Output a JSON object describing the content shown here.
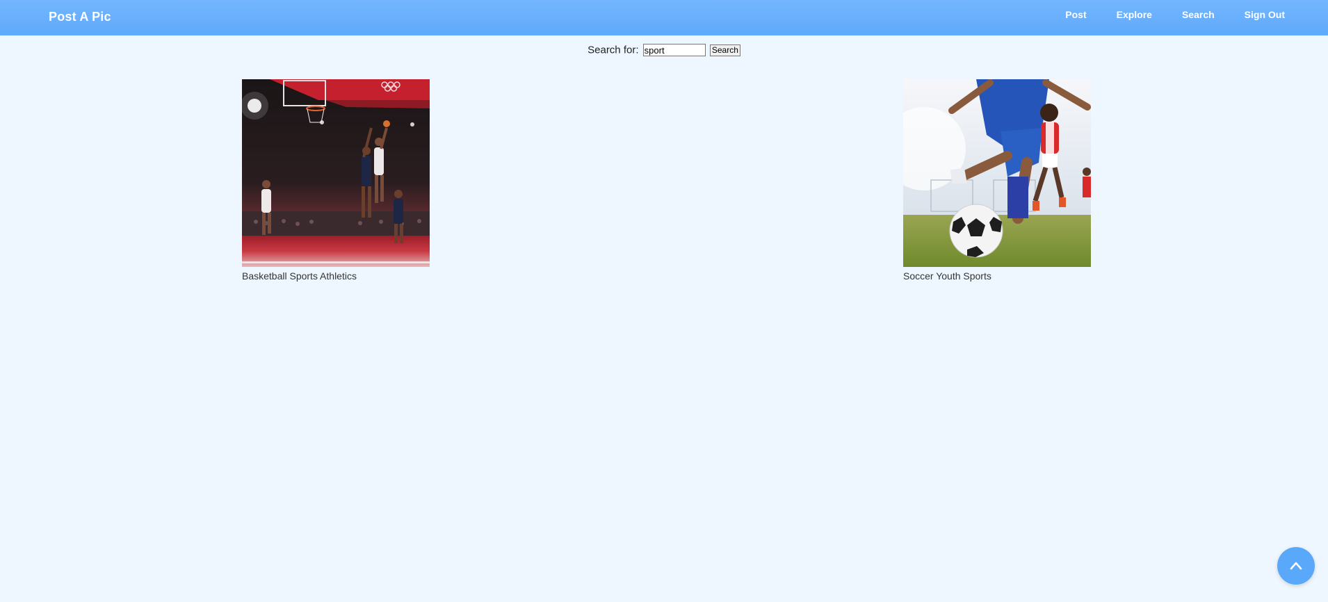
{
  "navbar": {
    "brand": "Post A Pic",
    "links": [
      "Post",
      "Explore",
      "Search",
      "Sign Out"
    ]
  },
  "search": {
    "label": "Search for:",
    "value": "sport",
    "button_label": "Search"
  },
  "results": [
    {
      "caption": "Basketball Sports Athletics",
      "image": "basketball-game-photo"
    },
    {
      "caption": "Soccer Youth Sports",
      "image": "soccer-kick-photo"
    }
  ],
  "scroll_top": {
    "icon": "chevron-up-icon"
  },
  "colors": {
    "navbar": "#66aefc",
    "background": "#eef7ff",
    "accent": "#5aa8f9"
  }
}
